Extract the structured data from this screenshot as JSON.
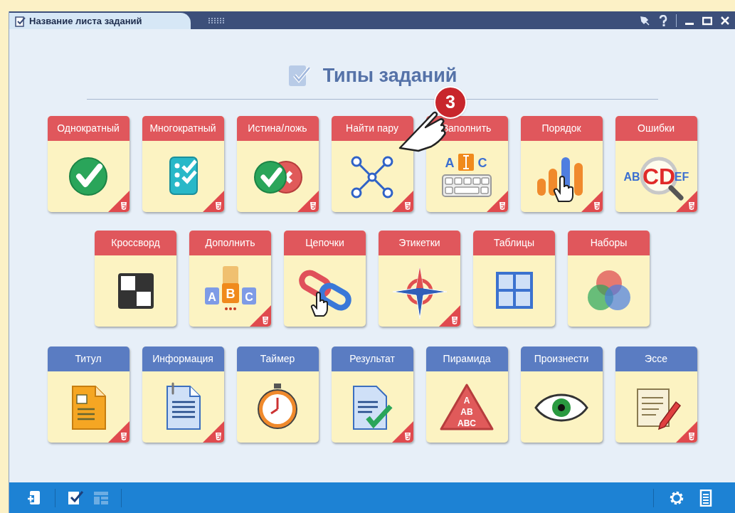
{
  "window": {
    "tab_title": "Название листа заданий"
  },
  "heading": "Типы заданий",
  "callout": {
    "number": "3"
  },
  "rows": [
    [
      {
        "title": "Однократный",
        "color": "#e0575c",
        "html5": true
      },
      {
        "title": "Многократный",
        "color": "#e0575c",
        "html5": true
      },
      {
        "title": "Истина/ложь",
        "color": "#e0575c",
        "html5": true
      },
      {
        "title": "Найти пару",
        "color": "#e0575c",
        "html5": true
      },
      {
        "title": "Заполнить",
        "color": "#e0575c",
        "html5": true,
        "icon_letters": [
          "A",
          "C"
        ]
      },
      {
        "title": "Порядок",
        "color": "#e0575c",
        "html5": true
      },
      {
        "title": "Ошибки",
        "color": "#e0575c",
        "html5": true,
        "icon_letters": [
          "AB",
          "CD",
          "EF"
        ]
      }
    ],
    [
      {
        "title": "Кроссворд",
        "color": "#e0575c",
        "html5": false
      },
      {
        "title": "Дополнить",
        "color": "#e0575c",
        "html5": true,
        "icon_letters": [
          "A",
          "B",
          "C"
        ]
      },
      {
        "title": "Цепочки",
        "color": "#e0575c",
        "html5": false
      },
      {
        "title": "Этикетки",
        "color": "#e0575c",
        "html5": true
      },
      {
        "title": "Таблицы",
        "color": "#e0575c",
        "html5": false
      },
      {
        "title": "Наборы",
        "color": "#e0575c",
        "html5": false
      }
    ],
    [
      {
        "title": "Титул",
        "color": "#5a7cc2",
        "html5": true
      },
      {
        "title": "Информация",
        "color": "#5a7cc2",
        "html5": true
      },
      {
        "title": "Таймер",
        "color": "#5a7cc2",
        "html5": false
      },
      {
        "title": "Результат",
        "color": "#5a7cc2",
        "html5": true
      },
      {
        "title": "Пирамида",
        "color": "#5a7cc2",
        "html5": false,
        "icon_letters": [
          "A",
          "AB",
          "ABC"
        ]
      },
      {
        "title": "Произнести",
        "color": "#5a7cc2",
        "html5": false
      },
      {
        "title": "Эссе",
        "color": "#5a7cc2",
        "html5": true
      }
    ]
  ],
  "bottom_toolbar": [
    {
      "kind": "add",
      "disabled": false
    },
    {
      "kind": "checklist",
      "disabled": false
    },
    {
      "kind": "layout",
      "disabled": true
    }
  ]
}
